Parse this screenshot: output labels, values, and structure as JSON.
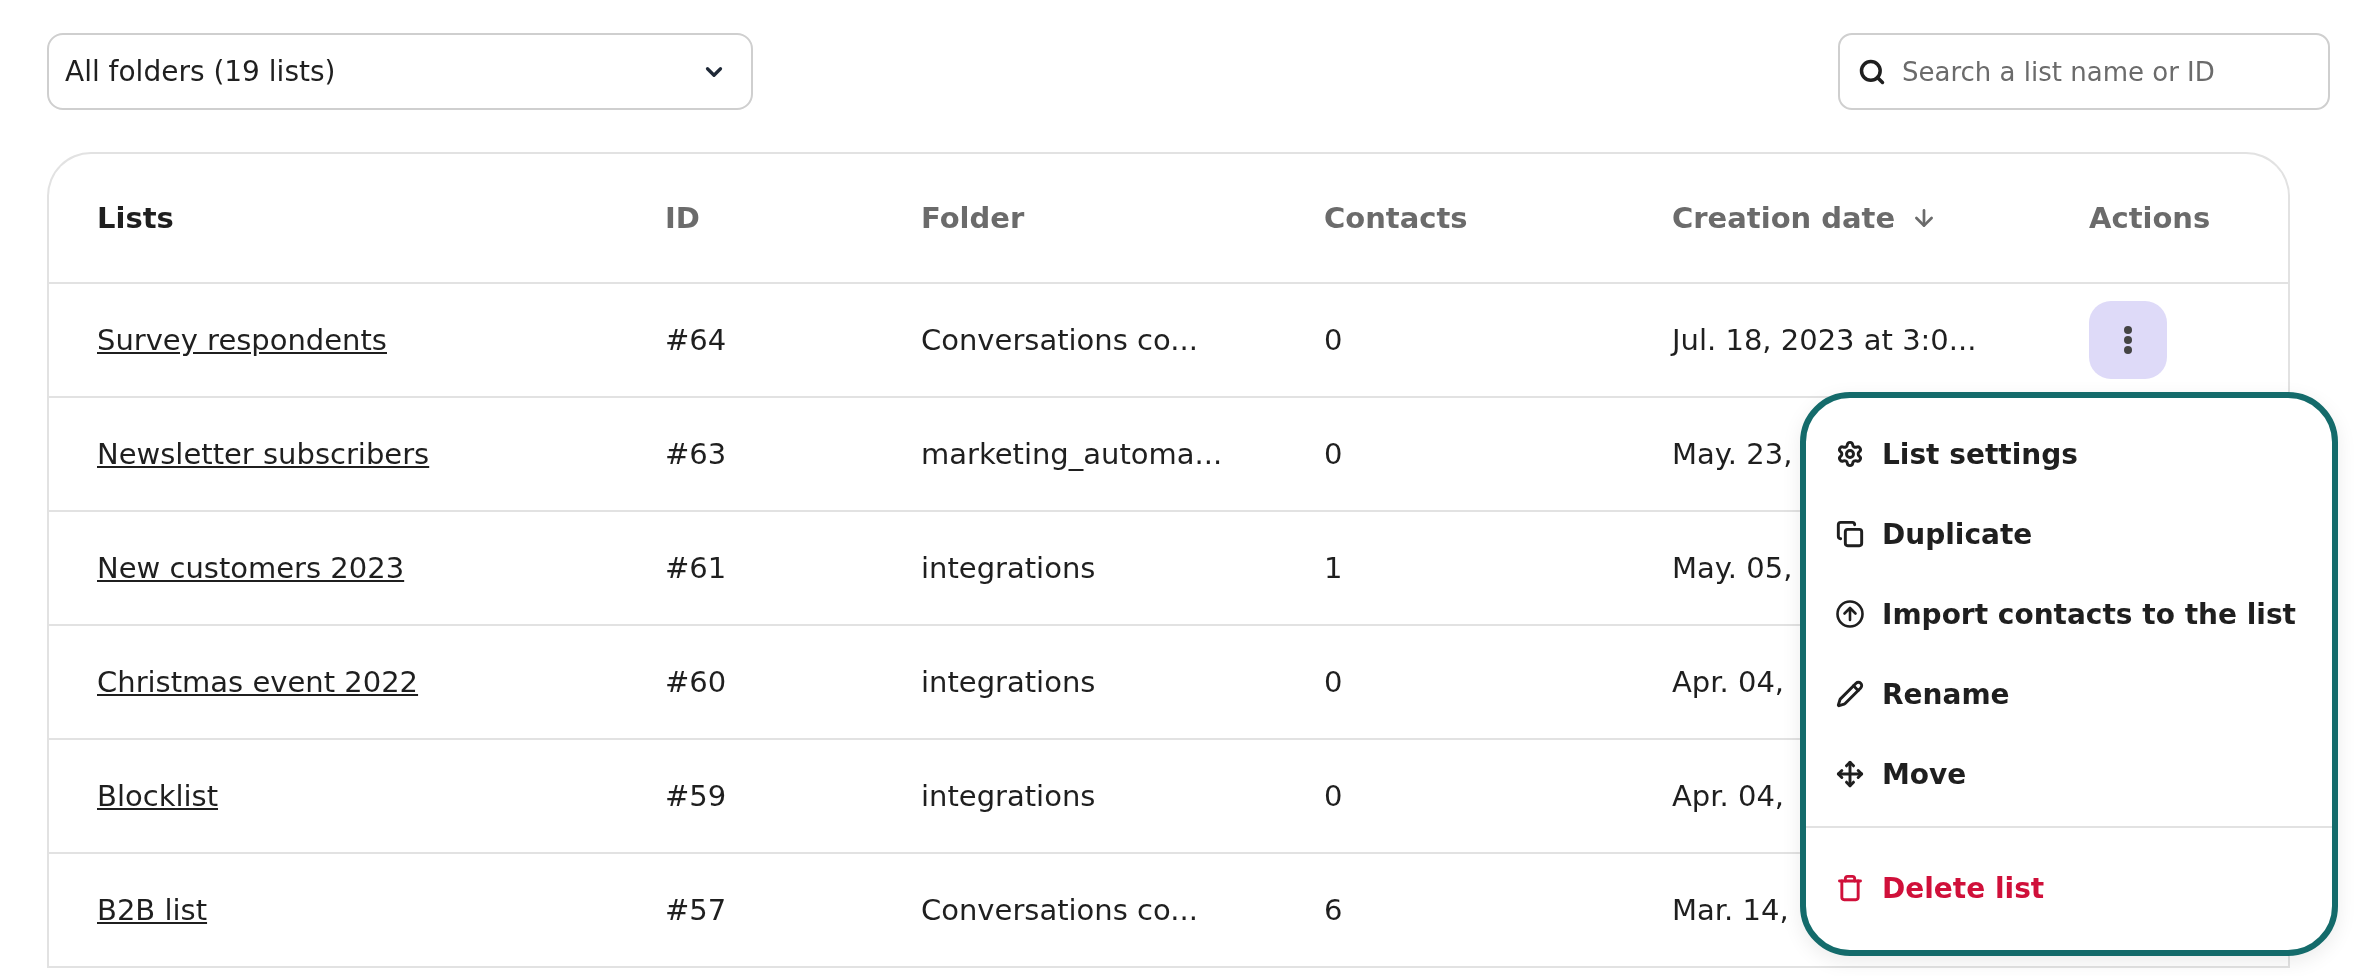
{
  "folder_select": {
    "value": "All folders (19 lists)"
  },
  "search": {
    "placeholder": "Search a list name or ID"
  },
  "table": {
    "columns": [
      {
        "label": "Lists",
        "sorted": false
      },
      {
        "label": "ID",
        "sorted": false
      },
      {
        "label": "Folder",
        "sorted": false
      },
      {
        "label": "Contacts",
        "sorted": false
      },
      {
        "label": "Creation date",
        "sorted": true
      },
      {
        "label": "Actions",
        "sorted": false
      }
    ],
    "rows": [
      {
        "name": "Survey respondents",
        "id": "#64",
        "folder": "Conversations co...",
        "contacts": "0",
        "created": "Jul. 18, 2023 at 3:0...",
        "menu_open": true
      },
      {
        "name": "Newsletter subscribers",
        "id": "#63",
        "folder": "marketing_automa...",
        "contacts": "0",
        "created": "May. 23,",
        "menu_open": false
      },
      {
        "name": "New customers 2023",
        "id": "#61",
        "folder": "integrations",
        "contacts": "1",
        "created": "May. 05,",
        "menu_open": false
      },
      {
        "name": "Christmas event 2022",
        "id": "#60",
        "folder": "integrations",
        "contacts": "0",
        "created": "Apr. 04,",
        "menu_open": false
      },
      {
        "name": "Blocklist",
        "id": "#59",
        "folder": "integrations",
        "contacts": "0",
        "created": "Apr. 04,",
        "menu_open": false
      },
      {
        "name": "B2B list",
        "id": "#57",
        "folder": "Conversations co...",
        "contacts": "6",
        "created": "Mar. 14,",
        "menu_open": false
      }
    ]
  },
  "action_menu": {
    "items": [
      {
        "label": "List settings",
        "kind": "normal"
      },
      {
        "label": "Duplicate",
        "kind": "normal"
      },
      {
        "label": "Import contacts to the list",
        "kind": "normal"
      },
      {
        "label": "Rename",
        "kind": "normal"
      },
      {
        "label": "Move",
        "kind": "normal"
      },
      {
        "label": "Delete list",
        "kind": "danger"
      }
    ]
  }
}
